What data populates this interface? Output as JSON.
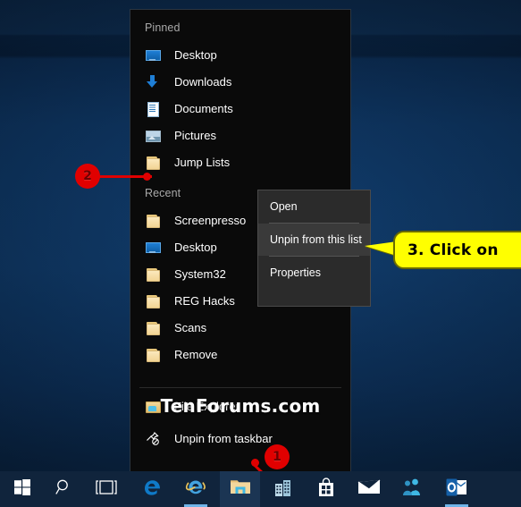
{
  "desktop": {
    "wallpaper_color": "#0d3461",
    "watermark": "TenForums.com"
  },
  "jumplist": {
    "pinned_header": "Pinned",
    "pinned_items": [
      {
        "label": "Desktop",
        "icon": "desktop-icon"
      },
      {
        "label": "Downloads",
        "icon": "download-icon"
      },
      {
        "label": "Documents",
        "icon": "document-icon"
      },
      {
        "label": "Pictures",
        "icon": "pictures-icon"
      },
      {
        "label": "Jump Lists",
        "icon": "folder-icon"
      }
    ],
    "recent_header": "Recent",
    "recent_items": [
      {
        "label": "Screenpresso",
        "icon": "folder-icon"
      },
      {
        "label": "Desktop",
        "icon": "desktop-icon"
      },
      {
        "label": "System32",
        "icon": "folder-icon"
      },
      {
        "label": "REG Hacks",
        "icon": "folder-icon"
      },
      {
        "label": "Scans",
        "icon": "folder-icon"
      },
      {
        "label": "Remove",
        "icon": "folder-icon"
      }
    ],
    "app_item": {
      "label": "File Explorer",
      "icon": "file-explorer-icon"
    },
    "unpin_item": {
      "label": "Unpin from taskbar",
      "icon": "unpin-icon"
    }
  },
  "context_menu": {
    "items": [
      {
        "label": "Open",
        "selected": false
      },
      {
        "label": "Unpin from this list",
        "selected": true
      },
      {
        "label": "Properties",
        "selected": false
      }
    ]
  },
  "callout": {
    "text": "3. Click on",
    "fill": "#ffff00",
    "stroke": "#6b6b00"
  },
  "markers": [
    {
      "number": "1",
      "color": "#e00000"
    },
    {
      "number": "2",
      "color": "#e00000"
    }
  ],
  "taskbar": {
    "background": "#10243c",
    "items": [
      {
        "name": "start-button",
        "icon": "windows-logo-icon",
        "active": false,
        "running": false
      },
      {
        "name": "search-button",
        "icon": "search-icon",
        "active": false,
        "running": false
      },
      {
        "name": "task-view-button",
        "icon": "task-view-icon",
        "active": false,
        "running": false
      },
      {
        "name": "microsoft-edge",
        "icon": "edge-icon",
        "active": false,
        "running": false
      },
      {
        "name": "internet-explorer",
        "icon": "internet-explorer-icon",
        "active": false,
        "running": true
      },
      {
        "name": "file-explorer",
        "icon": "file-explorer-icon",
        "active": true,
        "running": false
      },
      {
        "name": "store-apps",
        "icon": "buildings-icon",
        "active": false,
        "running": false
      },
      {
        "name": "microsoft-store",
        "icon": "shopping-bag-icon",
        "active": false,
        "running": false
      },
      {
        "name": "mail",
        "icon": "mail-envelope-icon",
        "active": false,
        "running": false
      },
      {
        "name": "people",
        "icon": "people-icon",
        "active": false,
        "running": false
      },
      {
        "name": "outlook",
        "icon": "outlook-icon",
        "active": false,
        "running": true
      }
    ]
  }
}
